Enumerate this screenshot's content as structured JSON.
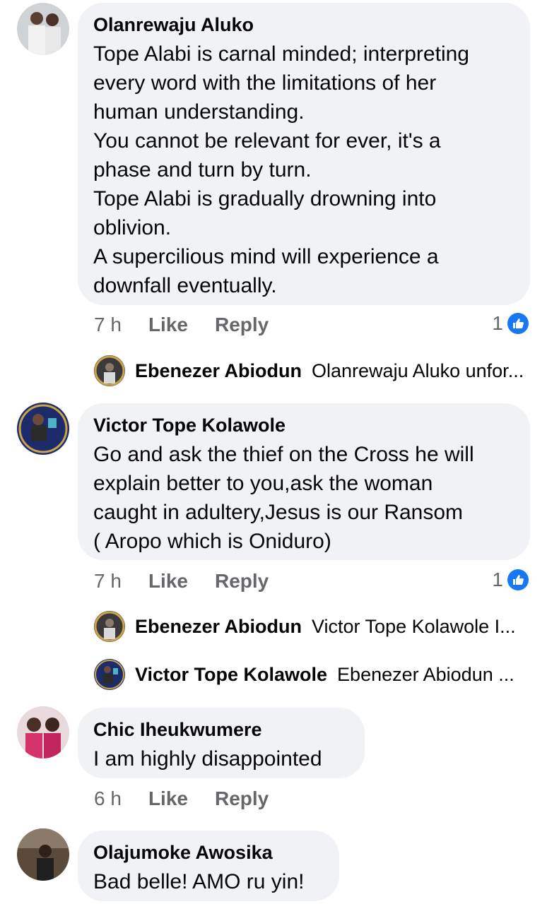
{
  "comments": [
    {
      "author": "Olanrewaju Aluko",
      "text": "Tope Alabi is carnal minded; interpreting\nevery word with the limitations of her\nhuman understanding.\nYou cannot be relevant for ever, it's a\nphase and turn by turn.\nTope Alabi is gradually drowning into\noblivion.\nA supercilious mind will experience a\ndownfall eventually.",
      "time": "7 h",
      "like": "Like",
      "reply": "Reply",
      "reactions": "1",
      "replies": [
        {
          "name": "Ebenezer Abiodun",
          "snippet": "Olanrewaju Aluko unfor..."
        }
      ]
    },
    {
      "author": "Victor Tope Kolawole",
      "text": "Go and ask the thief on the Cross he will\nexplain better to you,ask the woman\ncaught in adultery,Jesus is our Ransom\n( Aropo which is Oniduro)",
      "time": "7 h",
      "like": "Like",
      "reply": "Reply",
      "reactions": "1",
      "replies": [
        {
          "name": "Ebenezer Abiodun",
          "snippet": "Victor Tope Kolawole I..."
        },
        {
          "name": "Victor Tope Kolawole",
          "snippet": "Ebenezer Abiodun ..."
        }
      ]
    },
    {
      "author": "Chic Iheukwumere",
      "text": "I am highly disappointed",
      "time": "6 h",
      "like": "Like",
      "reply": "Reply"
    },
    {
      "author": "Olajumoke Awosika",
      "text": "Bad belle! AMO ru yin!"
    }
  ],
  "colors": {
    "bubble": "#f0f2f5",
    "meta": "#65676b",
    "like_blue": "#1877f2"
  }
}
